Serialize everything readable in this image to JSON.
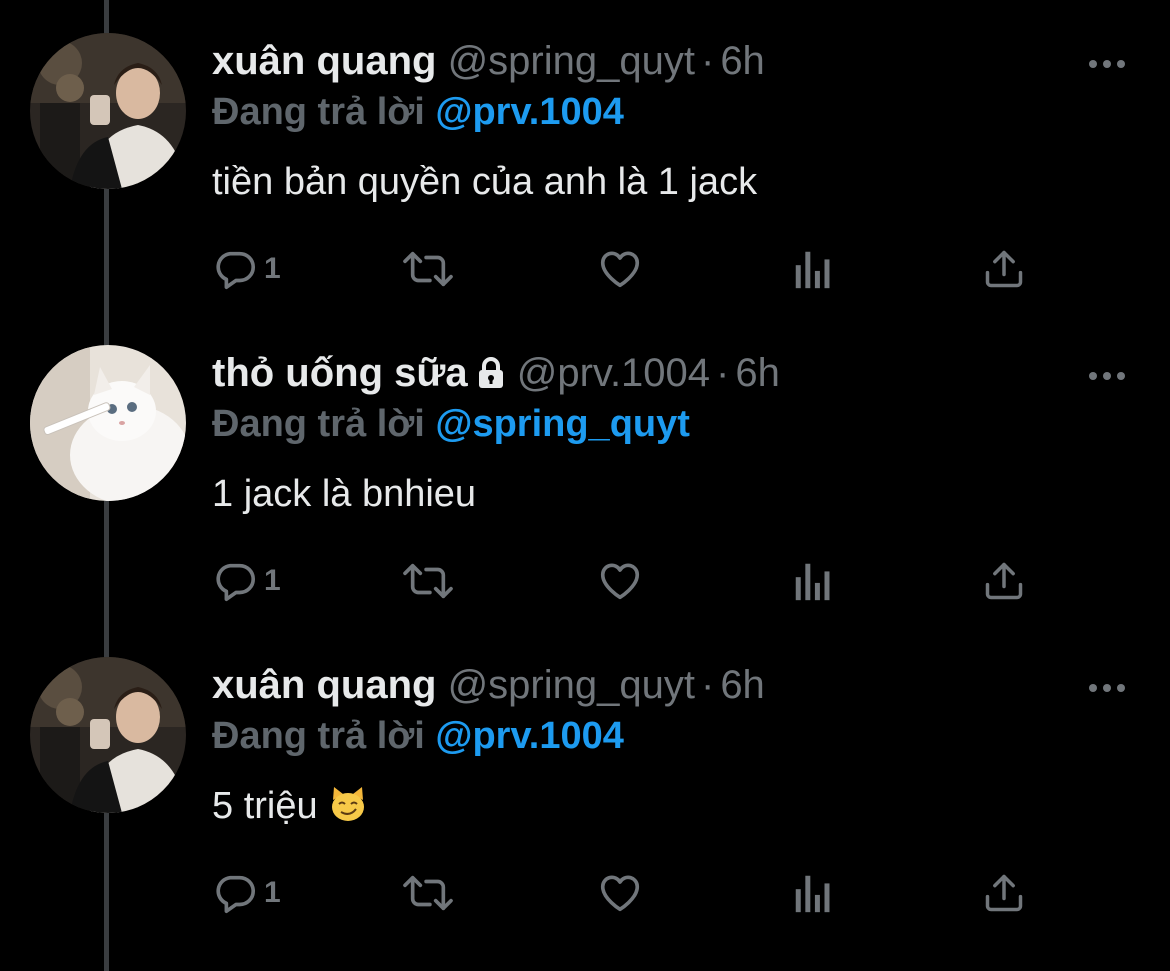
{
  "tweets": [
    {
      "display_name": "xuân quang",
      "handle": "@spring_quyt",
      "separator": "·",
      "time": "6h",
      "protected": false,
      "reply_prefix": "Đang trả lời",
      "reply_mention": "@prv.1004",
      "text": "tiền bản quyền của anh là 1 jack",
      "emoji": "",
      "reply_count": "1",
      "avatar": "man-photo"
    },
    {
      "display_name": "thỏ uống sữa",
      "handle": "@prv.1004",
      "separator": "·",
      "time": "6h",
      "protected": true,
      "reply_prefix": "Đang trả lời",
      "reply_mention": "@spring_quyt",
      "text": "1 jack là bnhieu",
      "emoji": "",
      "reply_count": "1",
      "avatar": "white-cat-photo"
    },
    {
      "display_name": "xuân quang",
      "handle": "@spring_quyt",
      "separator": "·",
      "time": "6h",
      "protected": false,
      "reply_prefix": "Đang trả lời",
      "reply_mention": "@prv.1004",
      "text": "5 triệu",
      "emoji": "smirking-cat-emoji",
      "reply_count": "1",
      "avatar": "man-photo"
    }
  ],
  "icons": {
    "reply": "comment-icon",
    "retweet": "retweet-icon",
    "like": "heart-icon",
    "views": "analytics-icon",
    "share": "share-icon",
    "more": "more-icon",
    "lock": "lock-icon"
  },
  "colors": {
    "background": "#000000",
    "text": "#e7e9ea",
    "muted": "#71767b",
    "accent": "#1d9bf0",
    "thread_line": "#3a3d40"
  }
}
